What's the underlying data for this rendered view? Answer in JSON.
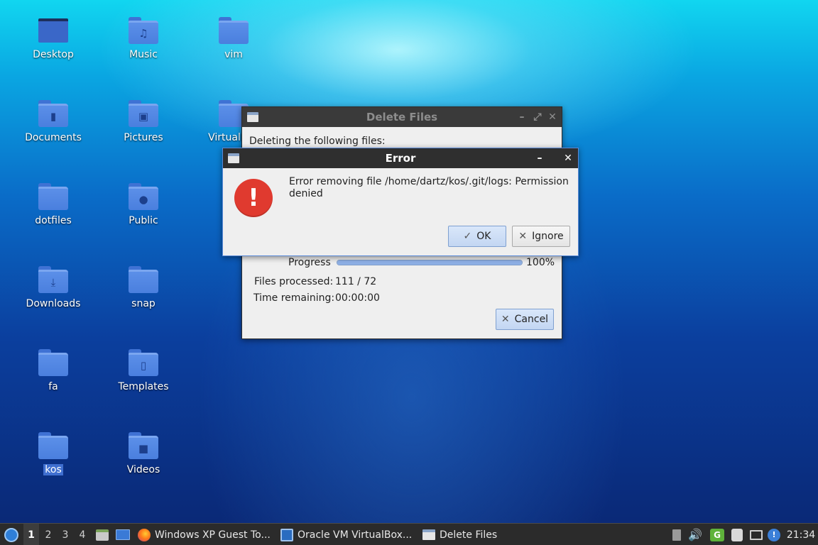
{
  "desktop": {
    "icons": [
      {
        "label": "Desktop",
        "glyph": ""
      },
      {
        "label": "Music",
        "glyph": "♫"
      },
      {
        "label": "vim",
        "glyph": ""
      },
      {
        "label": "Documents",
        "glyph": "▮"
      },
      {
        "label": "Pictures",
        "glyph": "▣"
      },
      {
        "label": "VirtualBox",
        "glyph": ""
      },
      {
        "label": "dotfiles",
        "glyph": ""
      },
      {
        "label": "Public",
        "glyph": "●"
      },
      {
        "label": "Downloads",
        "glyph": "⤓"
      },
      {
        "label": "snap",
        "glyph": ""
      },
      {
        "label": "fa",
        "glyph": ""
      },
      {
        "label": "Templates",
        "glyph": "▯"
      },
      {
        "label": "kos",
        "glyph": ""
      },
      {
        "label": "Videos",
        "glyph": "■"
      }
    ]
  },
  "delete_dialog": {
    "title": "Delete Files",
    "message": "Deleting the following files:",
    "progress_label": "Progress",
    "progress_percent": "100%",
    "progress_value": 1.0,
    "files_processed_label": "Files processed:",
    "files_processed_value": "111 / 72",
    "time_remaining_label": "Time remaining:",
    "time_remaining_value": "00:00:00",
    "cancel_label": "Cancel",
    "minimize_glyph": "–",
    "maximize_glyph": "⤢",
    "close_glyph": "✕"
  },
  "error_dialog": {
    "title": "Error",
    "message_line1": "Error removing file /home/dartz/kos/.git/logs: Permission",
    "message_line2": "denied",
    "icon_glyph": "!",
    "ok_label": "OK",
    "ok_glyph": "✓",
    "ignore_label": "Ignore",
    "ignore_glyph": "✕",
    "minimize_glyph": "–",
    "close_glyph": "✕"
  },
  "taskbar": {
    "workspaces": [
      "1",
      "2",
      "3",
      "4"
    ],
    "active_workspace": "1",
    "tasks": [
      {
        "label": "Windows XP Guest To...",
        "icon": "firefox-icon"
      },
      {
        "label": "Oracle VM VirtualBox...",
        "icon": "virtualbox-icon"
      },
      {
        "label": "Delete Files",
        "icon": "window-icon"
      }
    ],
    "clock": "21:34"
  },
  "colors": {
    "accent": "#4a7fde",
    "error_red": "#e03a2f",
    "progress_fill": "#8eb0e6"
  }
}
